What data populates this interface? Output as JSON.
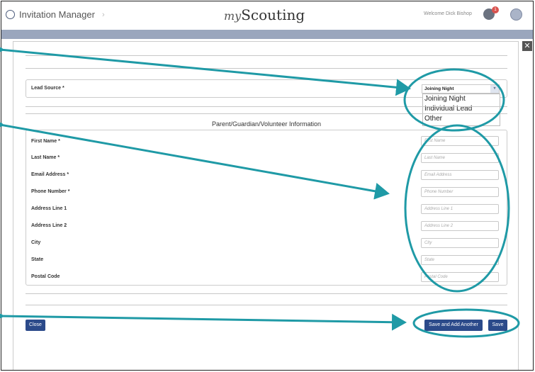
{
  "header": {
    "app_name": "Invitation Manager",
    "brand_prefix": "my",
    "brand_main": "Scouting",
    "welcome_text": "Welcome Dick Bishop",
    "notification_count": "1"
  },
  "form": {
    "lead_source_label": "Lead Source *",
    "lead_source_value": "Joining Night",
    "lead_source_options": [
      "Joining Night",
      "Individual Lead",
      "Other"
    ],
    "section_title": "Parent/Guardian/Volunteer Information",
    "fields": [
      {
        "label": "First Name *",
        "placeholder": "First Name"
      },
      {
        "label": "Last Name *",
        "placeholder": "Last Name"
      },
      {
        "label": "Email Address *",
        "placeholder": "Email Address"
      },
      {
        "label": "Phone Number *",
        "placeholder": "Phone Number"
      },
      {
        "label": "Address Line 1",
        "placeholder": "Address Line 1"
      },
      {
        "label": "Address Line 2",
        "placeholder": "Address Line 2"
      },
      {
        "label": "City",
        "placeholder": "City"
      },
      {
        "label": "State",
        "placeholder": "State"
      },
      {
        "label": "Postal Code",
        "placeholder": "Postal Code"
      }
    ]
  },
  "buttons": {
    "close": "Close",
    "save_add": "Save and Add Another",
    "save": "Save"
  },
  "colors": {
    "primary_button": "#2b4a8a",
    "annotation": "#1f9aa6",
    "header_band": "#9aa6bd"
  }
}
